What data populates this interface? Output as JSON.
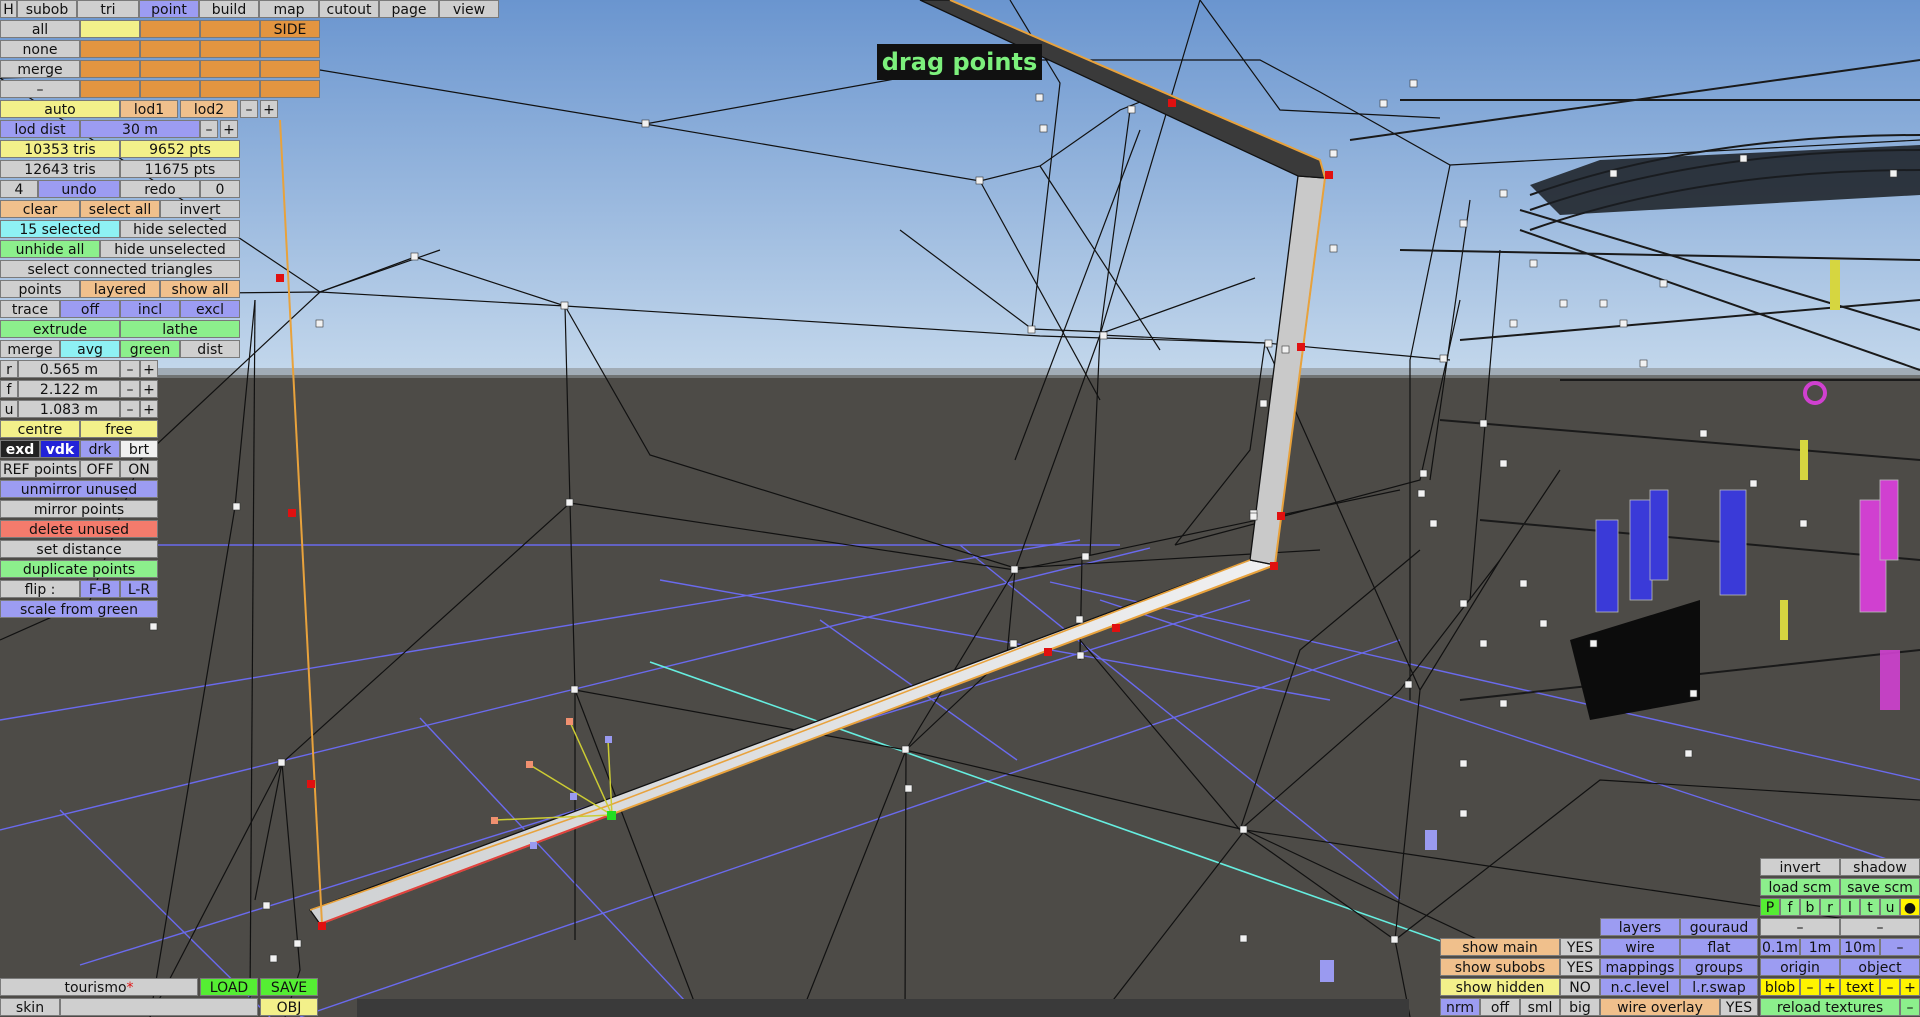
{
  "window": {
    "title": "drag points"
  },
  "top_menu": {
    "h": "H",
    "tabs": [
      "subob",
      "tri",
      "point",
      "build",
      "map",
      "cutout",
      "page",
      "view"
    ],
    "active": "point"
  },
  "select_grid": {
    "all": "all",
    "none": "none",
    "merge": "merge",
    "dash": "–",
    "side": "SIDE"
  },
  "lod": {
    "auto": "auto",
    "lod1": "lod1",
    "lod2": "lod2",
    "minus": "–",
    "plus": "+",
    "dist_label": "lod dist",
    "dist_value": "30 m"
  },
  "stats": {
    "tris1": "10353 tris",
    "pts1": "9652 pts",
    "tris2": "12643 tris",
    "pts2": "11675 pts"
  },
  "history": {
    "count": "4",
    "undo": "undo",
    "redo": "redo",
    "redo_count": "0"
  },
  "selection": {
    "clear": "clear",
    "select_all": "select all",
    "invert": "invert",
    "selected": "15 selected",
    "hide_selected": "hide selected",
    "unhide_all": "unhide all",
    "hide_unselected": "hide unselected",
    "select_connected": "select connected triangles"
  },
  "view_opts": {
    "points": "points",
    "layered": "layered",
    "show_all": "show all"
  },
  "trace": {
    "label": "trace",
    "off": "off",
    "incl": "incl",
    "excl": "excl"
  },
  "tools": {
    "extrude": "extrude",
    "lathe": "lathe",
    "merge": "merge",
    "avg": "avg",
    "green": "green",
    "dist": "dist"
  },
  "dims": [
    {
      "key": "r",
      "value": "0.565 m"
    },
    {
      "key": "f",
      "value": "2.122 m"
    },
    {
      "key": "u",
      "value": "1.083 m"
    }
  ],
  "pivot": {
    "centre": "centre",
    "free": "free"
  },
  "shade": {
    "exd": "exd",
    "vdk": "vdk",
    "drk": "drk",
    "brt": "brt"
  },
  "ref": {
    "label": "REF points",
    "off": "OFF",
    "on": "ON"
  },
  "actions": {
    "unmirror_unused": "unmirror unused",
    "mirror_points": "mirror points",
    "delete_unused": "delete unused",
    "set_distance": "set distance",
    "duplicate_points": "duplicate points",
    "flip_label": "flip :",
    "flip_fb": "F-B",
    "flip_lr": "L-R",
    "scale_from_green": "scale from green"
  },
  "file": {
    "name": "tourismo",
    "modified_mark": "*",
    "load": "LOAD",
    "save": "SAVE",
    "skin": "skin",
    "obj": "OBJ"
  },
  "display": {
    "show_main": "show main",
    "show_main_val": "YES",
    "show_subobs": "show subobs",
    "show_subobs_val": "YES",
    "show_hidden": "show hidden",
    "show_hidden_val": "NO",
    "nrm": "nrm",
    "off": "off",
    "sml": "sml",
    "big": "big",
    "layers": "layers",
    "gouraud": "gouraud",
    "wire": "wire",
    "flat": "flat",
    "mappings": "mappings",
    "groups": "groups",
    "nclevel": "n.c.level",
    "lrswap": "l.r.swap",
    "wire_overlay": "wire overlay",
    "wire_overlay_val": "YES"
  },
  "right_panel": {
    "invert": "invert",
    "shadow": "shadow",
    "load_scm": "load scm",
    "save_scm": "save scm",
    "toggles": [
      "P",
      "f",
      "b",
      "r",
      "l",
      "t",
      "u",
      "●"
    ],
    "dash1": "–",
    "dash2": "–",
    "steps": [
      "0.1m",
      "1m",
      "10m",
      "–"
    ],
    "origin": "origin",
    "object": "object",
    "blob": "blob",
    "blob_minus": "–",
    "blob_plus": "+",
    "text": "text",
    "text_minus": "–",
    "text_plus": "+",
    "reload": "reload textures",
    "dash3": "–"
  },
  "colors": {
    "sky_top": "#6a95cf",
    "sky_bottom": "#bcd3ea",
    "ground": "#4d4b47",
    "wire": "#111111",
    "grid": "#6a6aee",
    "selected_edge": "#e8a23c",
    "selected_point": "#e01010",
    "green_point": "#22dd22"
  }
}
